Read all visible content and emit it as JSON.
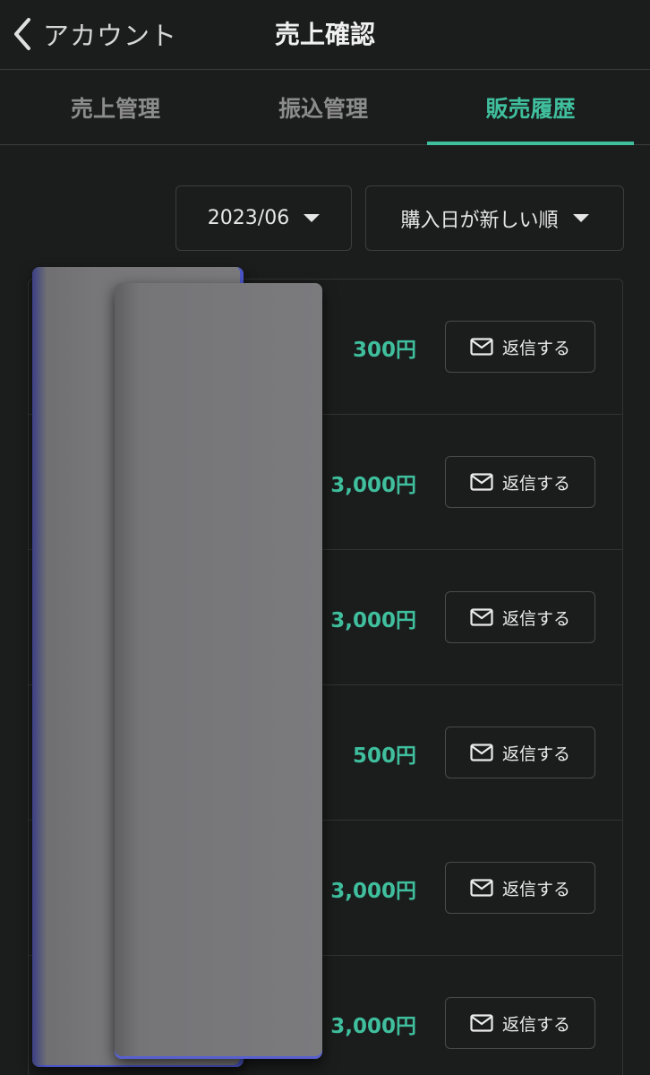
{
  "header": {
    "back_label": "アカウント",
    "title": "売上確認"
  },
  "tabs": [
    {
      "label": "売上管理",
      "active": false
    },
    {
      "label": "振込管理",
      "active": false
    },
    {
      "label": "販売履歴",
      "active": true
    }
  ],
  "filters": {
    "month": "2023/06",
    "sort": "購入日が新しい順"
  },
  "colors": {
    "accent": "#3fbf9d",
    "background": "#1b1c1c"
  },
  "sales": [
    {
      "price": "300円",
      "action": "返信する"
    },
    {
      "price": "3,000円",
      "action": "返信する"
    },
    {
      "price": "3,000円",
      "action": "返信する"
    },
    {
      "price": "500円",
      "action": "返信する"
    },
    {
      "price": "3,000円",
      "action": "返信する"
    },
    {
      "price": "3,000円",
      "action": "返信する"
    }
  ]
}
